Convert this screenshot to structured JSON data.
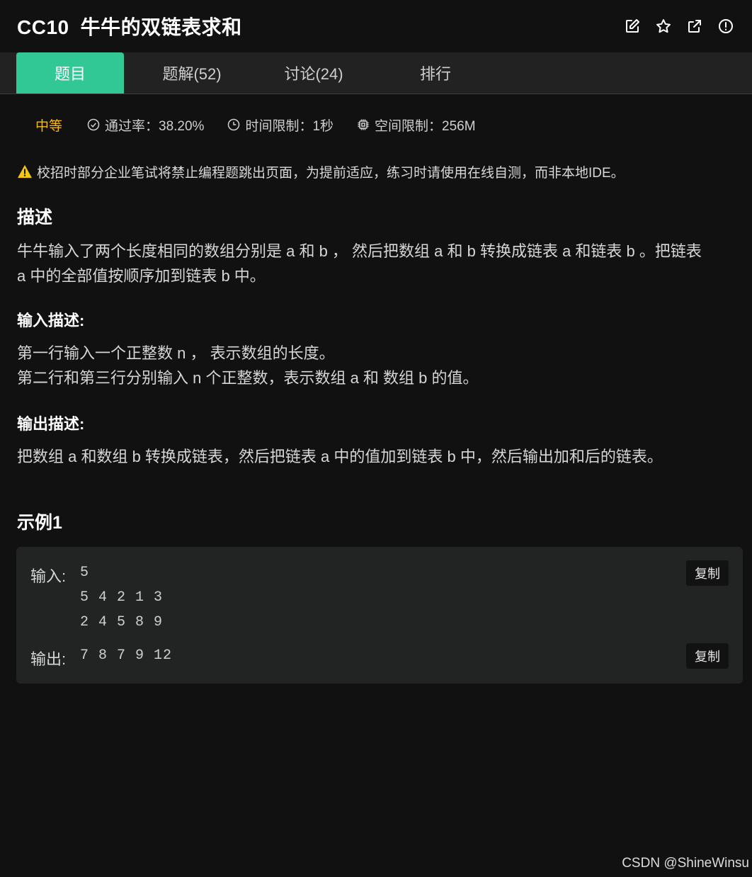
{
  "header": {
    "problem_id": "CC10",
    "problem_title": "牛牛的双链表求和",
    "icons": [
      "edit-icon",
      "star-icon",
      "external-link-icon",
      "info-icon"
    ]
  },
  "tabs": [
    {
      "label": "题目",
      "active": true
    },
    {
      "label": "题解(52)",
      "active": false
    },
    {
      "label": "讨论(24)",
      "active": false
    },
    {
      "label": "排行",
      "active": false
    }
  ],
  "meta": {
    "difficulty": "中等",
    "pass_rate": "通过率：38.20%",
    "time_limit": "时间限制：1秒",
    "space_limit": "空间限制：256M"
  },
  "notice": "校招时部分企业笔试将禁止编程题跳出页面，为提前适应，练习时请使用在线自测，而非本地IDE。",
  "description": {
    "title": "描述",
    "line1": "牛牛输入了两个长度相同的数组分别是 a 和 b ， 然后把数组 a 和 b 转换成链表 a 和链表 b 。把链表",
    "line2": "a 中的全部值按顺序加到链表 b 中。"
  },
  "input_desc": {
    "title": "输入描述:",
    "line1": "第一行输入一个正整数 n ， 表示数组的长度。",
    "line2": "第二行和第三行分别输入 n 个正整数，表示数组 a 和 数组 b 的值。"
  },
  "output_desc": {
    "title": "输出描述:",
    "line1": "把数组 a 和数组 b 转换成链表，然后把链表 a 中的值加到链表 b 中，然后输出加和后的链表。"
  },
  "example": {
    "title": "示例1",
    "input_label": "输入:",
    "input_lines": [
      "5",
      "5 4 2 1 3",
      "2 4 5 8 9"
    ],
    "output_label": "输出:",
    "output_value": "7 8 7 9 12",
    "copy_label": "复制"
  },
  "watermark": "CSDN @ShineWinsu",
  "colors": {
    "accent": "#32c896",
    "difficulty": "#f5b91c",
    "background": "#111111"
  }
}
